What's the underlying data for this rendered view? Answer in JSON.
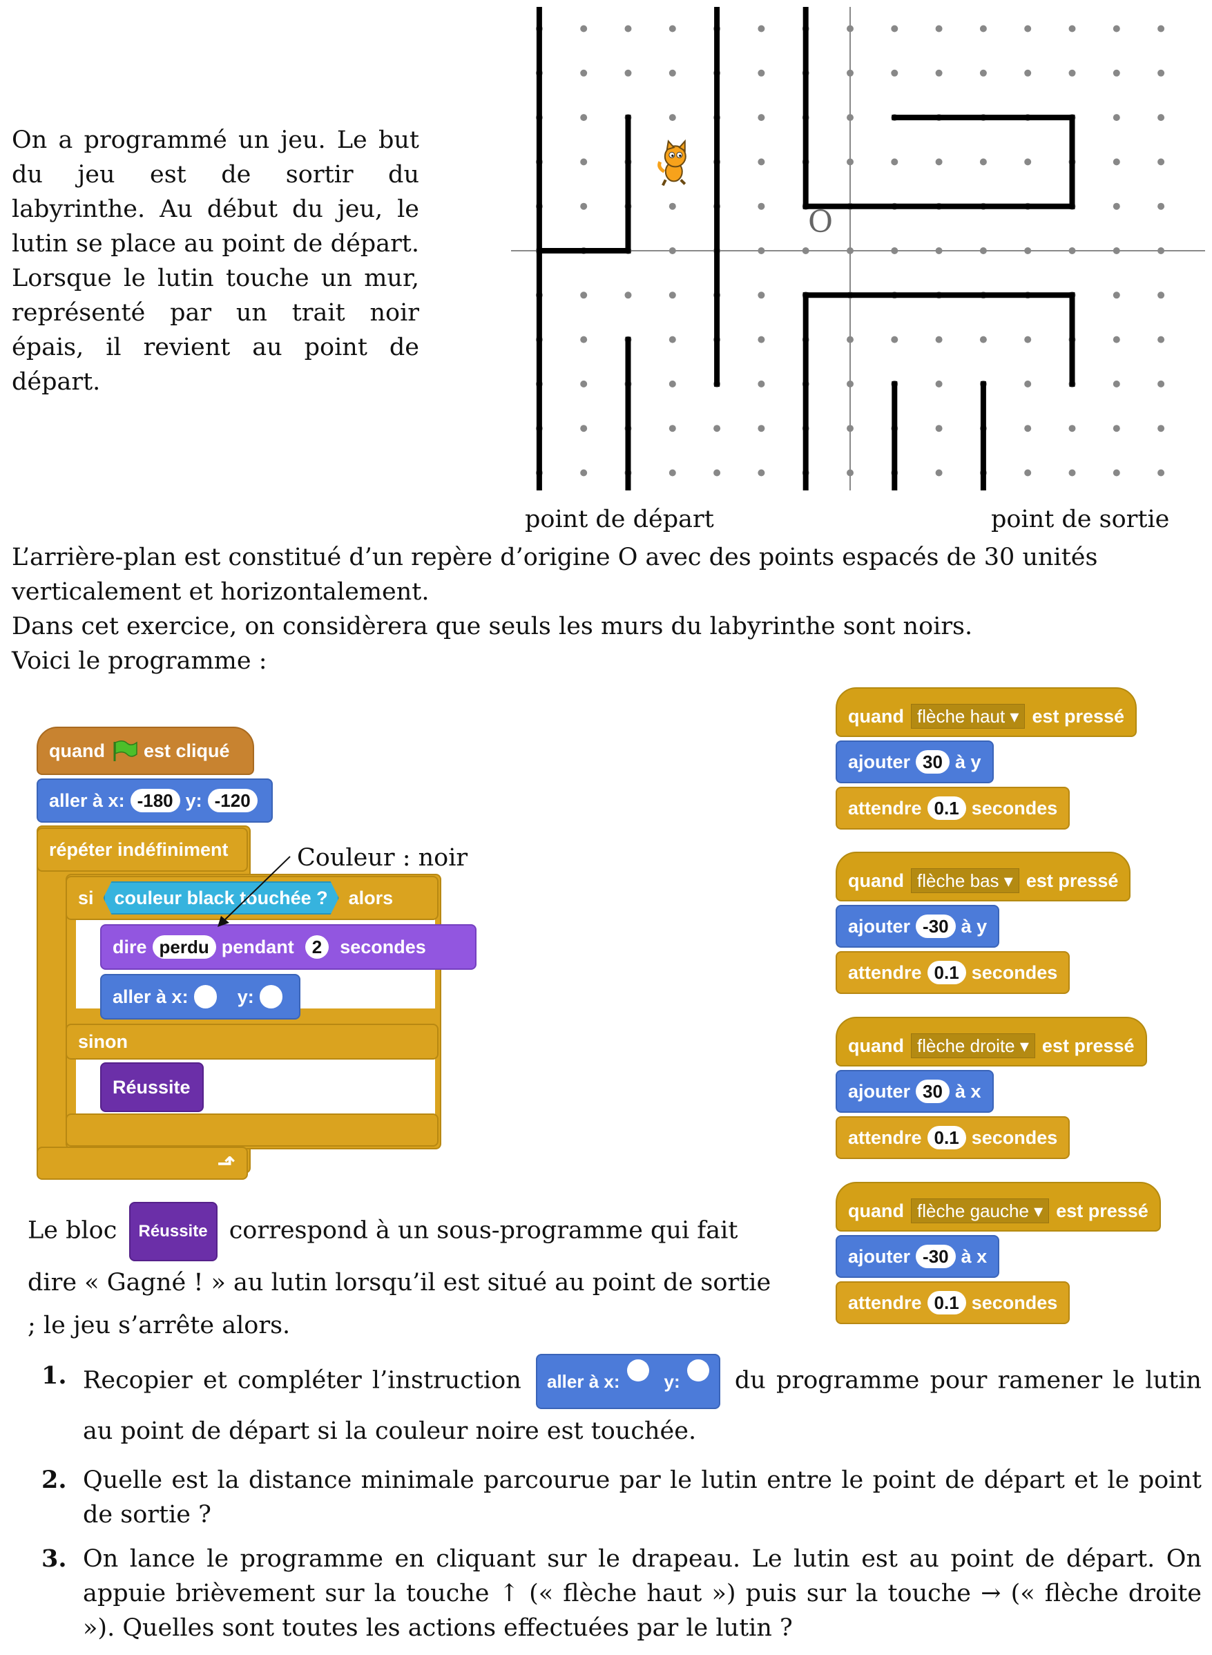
{
  "intro": "On a programmé un jeu. Le but du jeu est de sortir du labyrinthe. Au début du jeu, le lutin se place au point de départ. Lorsque le lutin touche un mur, représenté par un trait noir épais, il revient au point de départ.",
  "maze": {
    "origin_label": "O",
    "start_label": "point de départ",
    "exit_label": "point de sortie"
  },
  "para1": "L’arrière-plan est constitué d’un repère d’origine O avec des points espacés de 30 unités verticalement et horizontalement.",
  "para2": "Dans cet exercice, on considèrera que seuls les murs du labyrinthe sont noirs.",
  "para3": "Voici le programme :",
  "main_script": {
    "hat_when": "quand",
    "hat_clicked": "est cliqué",
    "goto_label": "aller à x:",
    "goto_x": "-180",
    "goto_y_label": "y:",
    "goto_y": "-120",
    "forever": "répéter indéfiniment",
    "if": "si",
    "sensing": "couleur  black  touchée ?",
    "then": "alors",
    "say": "dire",
    "say_text": "perdu",
    "say_for": "pendant",
    "say_secs": "2",
    "secs": "secondes",
    "goto2_label": "aller à x:",
    "goto2_y_label": "y:",
    "else": "sinon",
    "custom": "Réussite",
    "annotation": "Couleur : noir"
  },
  "key_scripts": [
    {
      "key": "flèche haut",
      "axis": "à y",
      "value": "30",
      "wait": "0.1"
    },
    {
      "key": "flèche bas",
      "axis": "à y",
      "value": "-30",
      "wait": "0.1"
    },
    {
      "key": "flèche droite",
      "axis": "à x",
      "value": "30",
      "wait": "0.1"
    },
    {
      "key": "flèche gauche",
      "axis": "à x",
      "value": "-30",
      "wait": "0.1"
    }
  ],
  "key_common": {
    "when": "quand",
    "pressed": "est pressé",
    "add": "ajouter",
    "wait_label": "attendre",
    "secs": "secondes"
  },
  "caption": {
    "before": "Le bloc",
    "block": "Réussite",
    "after": "correspond à un sous-programme qui fait dire « Gagné ! » au lutin lorsqu’il est situé au point de sortie ; le jeu s’arrête alors."
  },
  "questions": [
    {
      "num": "1.",
      "before": "Recopier et compléter l’instruction",
      "block_label": "aller à x:",
      "block_y": "y:",
      "after": "du programme pour ramener le lutin au point de départ si la couleur noire est touchée."
    },
    {
      "num": "2.",
      "text": "Quelle est la distance minimale parcourue par le lutin entre le point de départ et le point de sortie ?"
    },
    {
      "num": "3.",
      "text": "On lance le programme en cliquant sur le drapeau. Le lutin est au point de départ. On appuie brièvement sur la touche ↑ (« flèche haut ») puis sur la touche → (« flèche droite »). Quelles sont toutes les actions effectuées par le lutin ?"
    }
  ]
}
